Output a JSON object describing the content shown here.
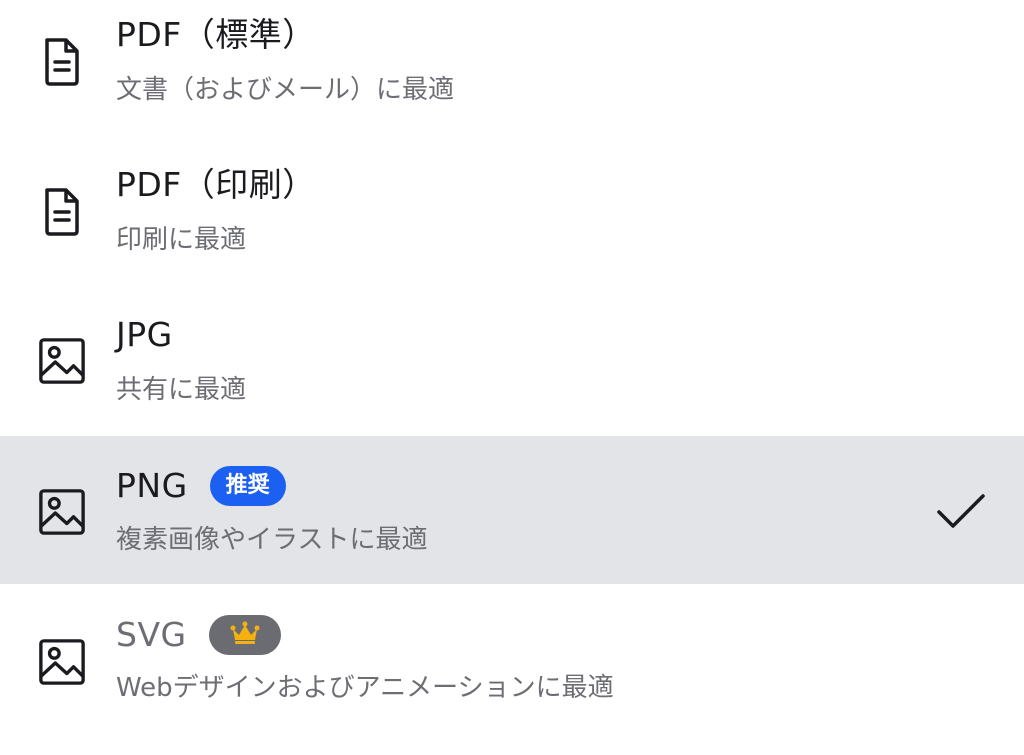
{
  "options": [
    {
      "title": "PDF（標準）",
      "subtitle": "文書（およびメール）に最適",
      "icon": "document-icon"
    },
    {
      "title": "PDF（印刷）",
      "subtitle": "印刷に最適",
      "icon": "document-icon"
    },
    {
      "title": "JPG",
      "subtitle": "共有に最適",
      "icon": "image-icon"
    },
    {
      "title": "PNG",
      "subtitle": "複素画像やイラストに最適",
      "icon": "image-icon",
      "badge": "推奨",
      "selected": true
    },
    {
      "title": "SVG",
      "subtitle": "Webデザインおよびアニメーションに最適",
      "icon": "image-icon",
      "pro_icon": "crown-icon"
    }
  ],
  "colors": {
    "selected_bg": "#e3e4e8",
    "badge_bg": "#1c60f2",
    "pro_badge_bg": "#6b6c72",
    "crown": "#f5b10f"
  }
}
